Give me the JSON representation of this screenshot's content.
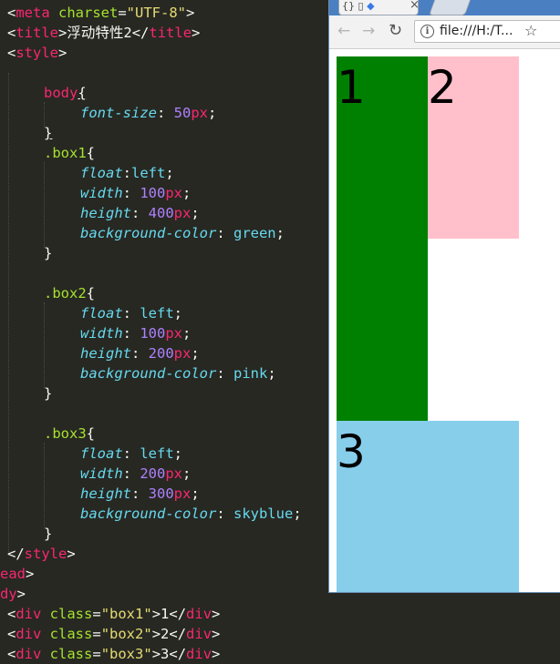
{
  "code": {
    "l1": {
      "open": "<",
      "tag": "meta",
      "attr": " charset",
      "eq": "=",
      "val": "\"UTF-8\"",
      "close": ">"
    },
    "l2": {
      "open": "<",
      "tag": "title",
      "close1": ">",
      "text": "浮动特性2",
      "open2": "</",
      "tag2": "title",
      "close2": ">"
    },
    "l3": {
      "open": "<",
      "tag": "style",
      "close": ">"
    },
    "l4": {
      "tag": "body",
      "brace": "{"
    },
    "l5": {
      "prop": "font-size",
      "colon": ": ",
      "num": "50",
      "unit": "px",
      "semi": ";"
    },
    "l6": {
      "brace": "}"
    },
    "l7": {
      "sel": ".box1",
      "brace": "{"
    },
    "l8": {
      "prop": "float",
      "colon": ":",
      "val": "left",
      "semi": ";"
    },
    "l9": {
      "prop": "width",
      "colon": ": ",
      "num": "100",
      "unit": "px",
      "semi": ";"
    },
    "l10": {
      "prop": "height",
      "colon": ": ",
      "num": "400",
      "unit": "px",
      "semi": ";"
    },
    "l11": {
      "prop": "background-color",
      "colon": ": ",
      "val": "green",
      "semi": ";"
    },
    "l12": {
      "brace": "}"
    },
    "l13": {
      "sel": ".box2",
      "brace": "{"
    },
    "l14": {
      "prop": "float",
      "colon": ": ",
      "val": "left",
      "semi": ";"
    },
    "l15": {
      "prop": "width",
      "colon": ": ",
      "num": "100",
      "unit": "px",
      "semi": ";"
    },
    "l16": {
      "prop": "height",
      "colon": ": ",
      "num": "200",
      "unit": "px",
      "semi": ";"
    },
    "l17": {
      "prop": "background-color",
      "colon": ": ",
      "val": "pink",
      "semi": ";"
    },
    "l18": {
      "brace": "}"
    },
    "l19": {
      "sel": ".box3",
      "brace": "{"
    },
    "l20": {
      "prop": "float",
      "colon": ": ",
      "val": "left",
      "semi": ";"
    },
    "l21": {
      "prop": "width",
      "colon": ": ",
      "num": "200",
      "unit": "px",
      "semi": ";"
    },
    "l22": {
      "prop": "height",
      "colon": ": ",
      "num": "300",
      "unit": "px",
      "semi": ";"
    },
    "l23": {
      "prop": "background-color",
      "colon": ": ",
      "val": "skyblue",
      "semi": ";"
    },
    "l24": {
      "brace": "}"
    },
    "l25": {
      "open": "</",
      "tag": "style",
      "close": ">"
    },
    "l26": {
      "tag": "ead",
      "close": ">"
    },
    "l27": {
      "tag": "dy",
      "close": ">"
    },
    "l28": {
      "open": "<",
      "tag": "div",
      "attr": " class",
      "eq": "=",
      "val": "\"box1\"",
      "close1": ">",
      "text": "1",
      "open2": "</",
      "tag2": "div",
      "close2": ">"
    },
    "l29": {
      "open": "<",
      "tag": "div",
      "attr": " class",
      "eq": "=",
      "val": "\"box2\"",
      "close1": ">",
      "text": "2",
      "open2": "</",
      "tag2": "div",
      "close2": ">"
    },
    "l30": {
      "open": "<",
      "tag": "div",
      "attr": " class",
      "eq": "=",
      "val": "\"box3\"",
      "close1": ">",
      "text": "3",
      "open2": "</",
      "tag2": "div",
      "close2": ">"
    }
  },
  "browser": {
    "tab_close": "×",
    "back": "←",
    "forward": "→",
    "reload": "↻",
    "info": "i",
    "url": "file:///H:/T...",
    "star": "☆",
    "boxes": {
      "box1": "1",
      "box2": "2",
      "box3": "3"
    }
  },
  "colors": {
    "box1": "green",
    "box2": "pink",
    "box3": "skyblue",
    "editor_bg": "#272822"
  }
}
